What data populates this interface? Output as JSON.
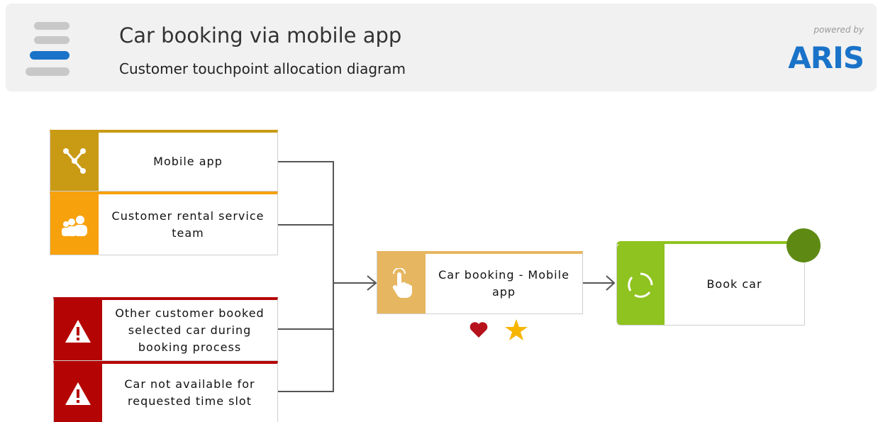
{
  "header": {
    "title": "Car booking via mobile app",
    "subtitle": "Customer touchpoint allocation diagram",
    "powered_by": "powered by",
    "brand": "ARIS"
  },
  "diagram": {
    "nodes": {
      "mobile_app": {
        "label": "Mobile app",
        "icon": "share-network-icon",
        "color": "#c99a14"
      },
      "rental_team": {
        "label": "Customer rental service team",
        "icon": "people-group-icon",
        "color": "#f7a10c"
      },
      "risk_booked": {
        "label": "Other customer booked selected car during booking process",
        "icon": "warning-icon",
        "color": "#b50404"
      },
      "risk_unavailable": {
        "label": "Car not available for requested time slot",
        "icon": "warning-icon",
        "color": "#b50404"
      },
      "touchpoint": {
        "label": "Car booking - Mobile app",
        "icon": "touch-hand-icon",
        "color": "#e6b660"
      },
      "process": {
        "label": "Book car",
        "icon": "cycle-process-icon",
        "color": "#8fc31f"
      }
    },
    "touchpoint_rating": {
      "heart_color": "#b5121b",
      "star_color": "#f7b500"
    },
    "status_color": "#5e8a14"
  }
}
